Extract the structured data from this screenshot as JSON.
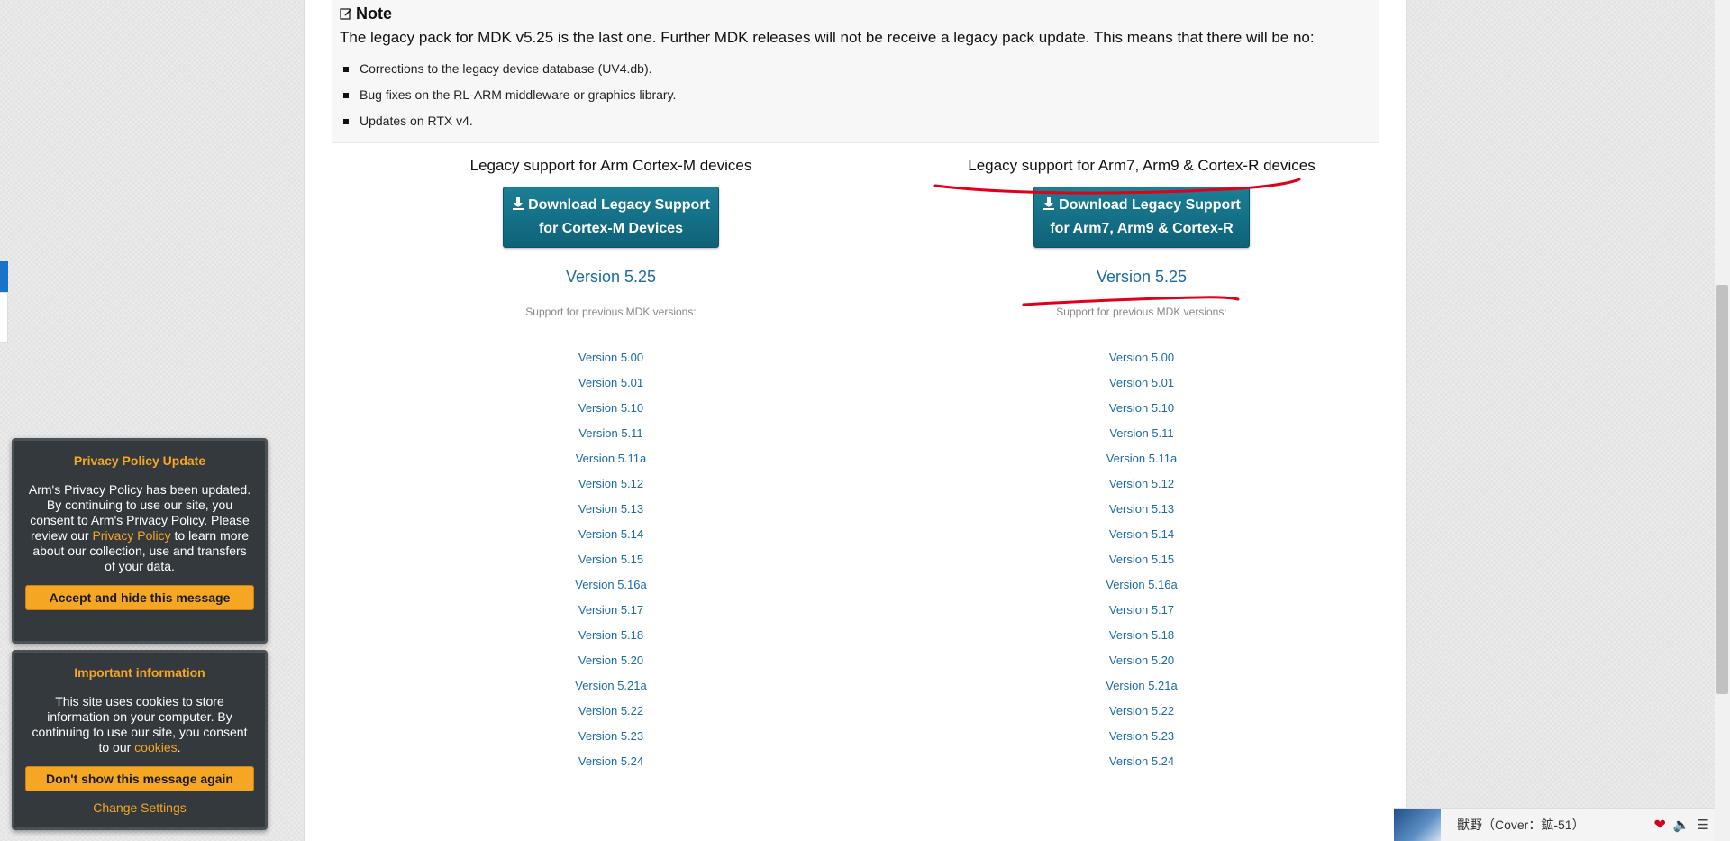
{
  "note": {
    "title": "Note",
    "text": "The legacy pack for MDK v5.25 is the last one. Further MDK releases will not be receive a legacy pack update. This means that there will be no:",
    "items": [
      "Corrections to the legacy device database (UV4.db).",
      "Bug fixes on the RL-ARM middleware or graphics library.",
      "Updates on RTX v4."
    ]
  },
  "columns": [
    {
      "title": "Legacy support for Arm Cortex-M devices",
      "button_line1": "Download Legacy Support",
      "button_line2": "for Cortex-M Devices",
      "version_main": "Version 5.25",
      "prev_label": "Support for previous MDK versions:",
      "versions": [
        "Version 5.00",
        "Version 5.01",
        "Version 5.10",
        "Version 5.11",
        "Version 5.11a",
        "Version 5.12",
        "Version 5.13",
        "Version 5.14",
        "Version 5.15",
        "Version 5.16a",
        "Version 5.17",
        "Version 5.18",
        "Version 5.20",
        "Version 5.21a",
        "Version 5.22",
        "Version 5.23",
        "Version 5.24"
      ]
    },
    {
      "title": "Legacy support for Arm7, Arm9 & Cortex-R devices",
      "button_line1": "Download Legacy Support",
      "button_line2": "for Arm7, Arm9 & Cortex-R",
      "version_main": "Version 5.25",
      "prev_label": "Support for previous MDK versions:",
      "versions": [
        "Version 5.00",
        "Version 5.01",
        "Version 5.10",
        "Version 5.11",
        "Version 5.11a",
        "Version 5.12",
        "Version 5.13",
        "Version 5.14",
        "Version 5.15",
        "Version 5.16a",
        "Version 5.17",
        "Version 5.18",
        "Version 5.20",
        "Version 5.21a",
        "Version 5.22",
        "Version 5.23",
        "Version 5.24"
      ]
    }
  ],
  "privacy": {
    "title": "Privacy Policy Update",
    "body_pre": "Arm's Privacy Policy has been updated. By continuing to use our site, you consent to Arm's Privacy Policy. Please review our ",
    "link": "Privacy Policy",
    "body_post": " to learn more about our collection, use and transfers of your data.",
    "button": "Accept and hide this message"
  },
  "cookies": {
    "title": "Important information",
    "body_pre": "This site uses cookies to store information on your computer. By continuing to use our site, you consent to our ",
    "link": "cookies",
    "body_post": ".",
    "button": "Don't show this message again",
    "settings_link": "Change Settings"
  },
  "media": {
    "title": "獸野（Cover：鉱-51）"
  },
  "colors": {
    "button_bg": "#1a7f96",
    "link": "#1b6aa5",
    "popup_accent": "#f5a623",
    "annotation": "#e0001a"
  },
  "icons": {
    "note": "edit-icon",
    "download": "download-icon",
    "like": "heart-icon",
    "volume": "volume-icon",
    "playlist": "playlist-icon"
  }
}
